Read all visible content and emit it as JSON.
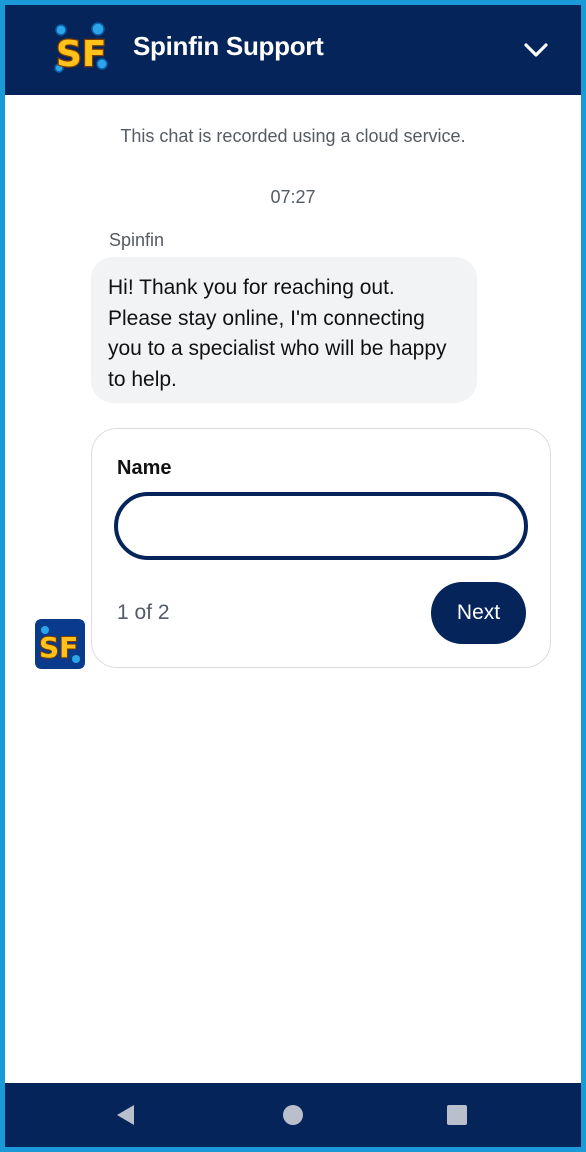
{
  "header": {
    "title": "Spinfin Support",
    "logo_icon": "spinfin-logo-icon",
    "collapse_icon": "chevron-down-icon"
  },
  "chat": {
    "notice": "This chat is recorded using a cloud service.",
    "time": "07:27",
    "sender": "Spinfin",
    "message": "Hi! Thank you for reaching out. Please stay online, I'm connecting you to a specialist who will be happy to help."
  },
  "form": {
    "label": "Name",
    "value": "",
    "placeholder": "",
    "pager": "1 of 2",
    "next_label": "Next"
  },
  "navbar": {
    "back_icon": "back-triangle-icon",
    "home_icon": "home-circle-icon",
    "recent_icon": "recent-apps-square-icon"
  },
  "colors": {
    "frame_border": "#1a9ad6",
    "brand_navy": "#04245a",
    "bubble_bg": "#f2f3f5",
    "muted_text": "#555b63"
  }
}
